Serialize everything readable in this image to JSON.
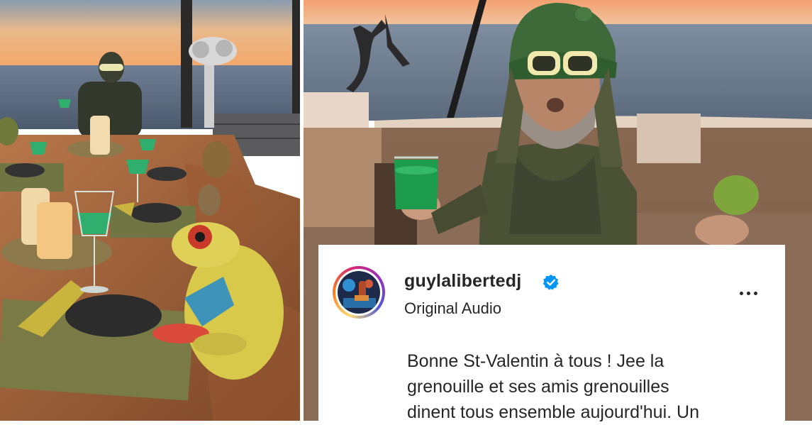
{
  "post": {
    "username": "guylalibertedj",
    "audio": "Original Audio",
    "caption_lines": [
      "Bonne St-Valentin à tous ! Jee la",
      "grenouille et ses amis grenouilles",
      "dinent tous ensemble aujourd'hui. Un"
    ],
    "verified": true
  },
  "icons": {
    "verified": "verified-badge-icon",
    "more": "more-options-icon"
  },
  "colors": {
    "verified_blue": "#0095f6",
    "text": "#262626",
    "avatar_ring": [
      "#feda75",
      "#fa7e1e",
      "#d62976",
      "#962fbf",
      "#4f5bd5"
    ]
  }
}
